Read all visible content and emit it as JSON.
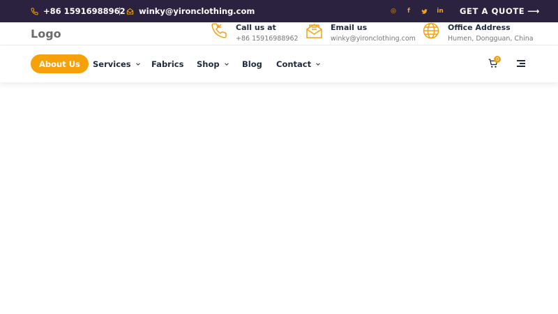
{
  "topbar": {
    "phone": "+86 15916988962",
    "email": "winky@yironclothing.com",
    "social": [
      {
        "name": "instagram-icon",
        "glyph": "◎"
      },
      {
        "name": "facebook-icon",
        "glyph": "f"
      },
      {
        "name": "twitter-icon",
        "glyph": "🐦"
      },
      {
        "name": "linkedin-icon",
        "glyph": "in"
      }
    ],
    "quote_label": "GET A QUOTE",
    "quote_arrow": "⟶"
  },
  "header": {
    "logo": "Logo",
    "info": [
      {
        "icon": "phone-icon",
        "title": "Call us at",
        "value": "+86 15916988962"
      },
      {
        "icon": "envelope-icon",
        "title": "Email us",
        "value": "winky@yironclothing.com"
      },
      {
        "icon": "globe-icon",
        "title": "Office Address",
        "value": "Humen, Dongguan, China"
      }
    ]
  },
  "nav": {
    "items": [
      {
        "label": "About Us",
        "active": true
      },
      {
        "label": "Services",
        "dropdown": true
      },
      {
        "label": "Fabrics"
      },
      {
        "label": "Shop",
        "dropdown": true
      },
      {
        "label": "Blog"
      },
      {
        "label": "Contact",
        "dropdown": true
      }
    ],
    "cart_count": "0"
  },
  "colors": {
    "topbar_bg": "#2b2240",
    "accent": "#f5a10a",
    "text_dark": "#1f2a3d"
  }
}
